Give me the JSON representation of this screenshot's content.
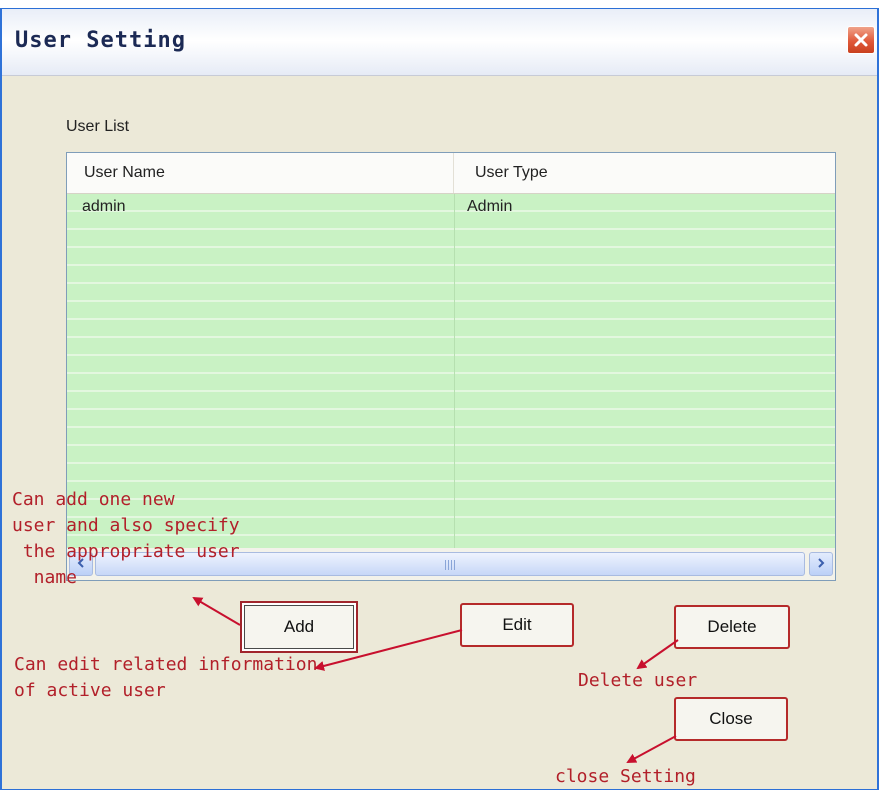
{
  "window": {
    "title": "User Setting",
    "close_icon": "close-icon"
  },
  "user_list": {
    "label": "User List",
    "columns": [
      "User Name",
      "User Type"
    ],
    "rows": [
      {
        "user_name": "admin",
        "user_type": "Admin"
      }
    ]
  },
  "buttons": {
    "add": "Add",
    "edit": "Edit",
    "delete": "Delete",
    "close": "Close"
  },
  "annotations": {
    "add_note": "Can add one new\nuser and also specify\n the appropriate user\n  name",
    "edit_note": "Can edit related information\nof active user",
    "delete_note": "Delete user",
    "close_note": "close Setting"
  },
  "colors": {
    "annotation": "#b2202a",
    "list_background": "#c9f2c4"
  }
}
